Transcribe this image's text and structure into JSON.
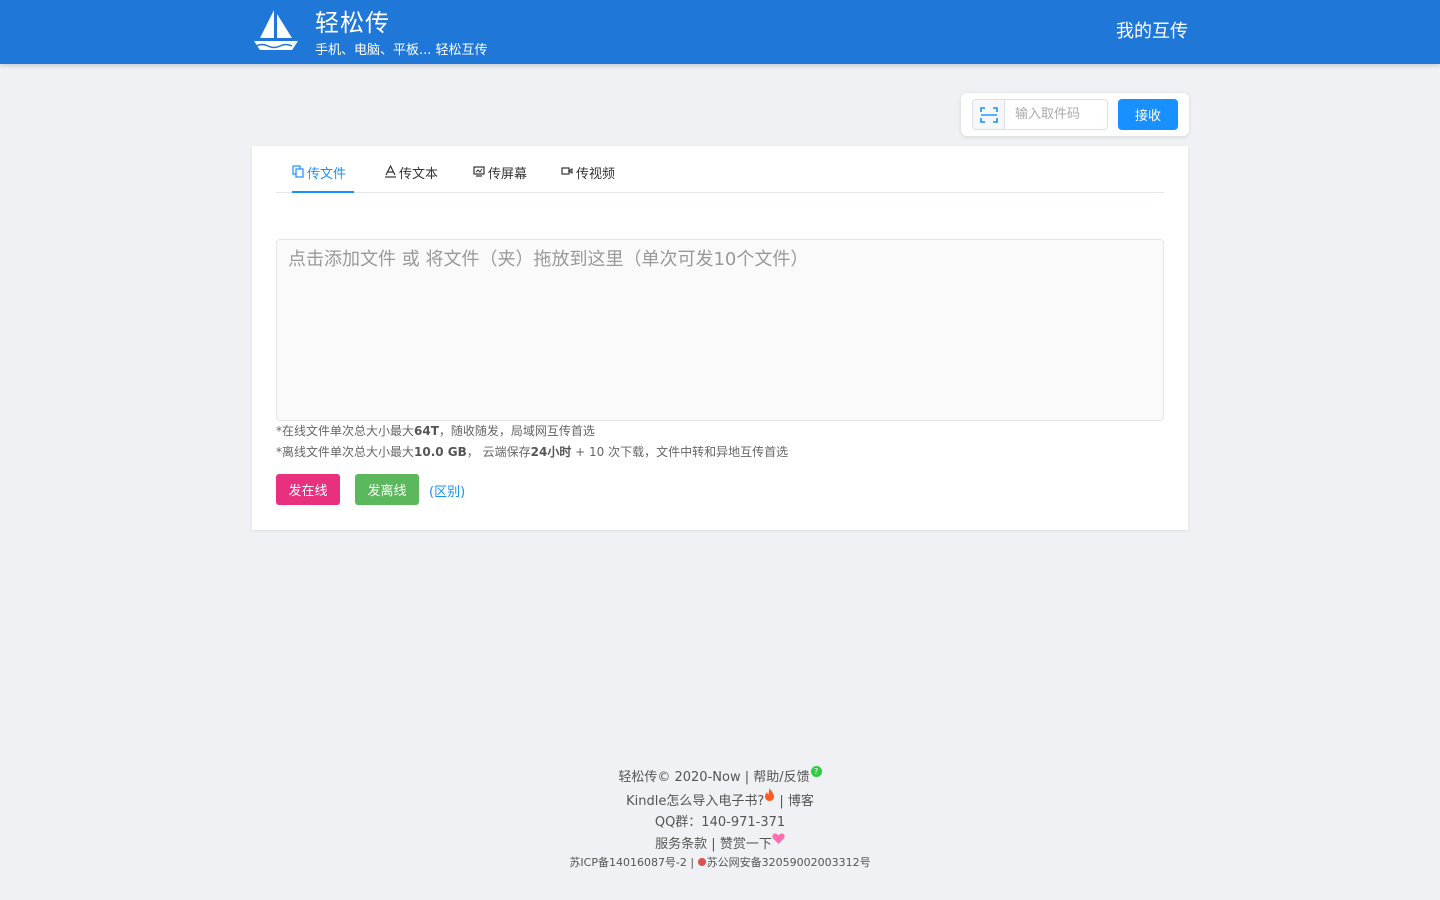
{
  "header": {
    "brand_title": "轻松传",
    "brand_subtitle": "手机、电脑、平板... 轻松互传",
    "my_transfers": "我的互传",
    "logo_icon": "sailboat-icon",
    "accent_color": "#1f78d8"
  },
  "receive": {
    "placeholder": "输入取件码",
    "button_label": "接收",
    "scan_icon": "scan-icon"
  },
  "tabs": [
    {
      "label": "传文件",
      "icon": "file-copy-icon",
      "active": true
    },
    {
      "label": "传文本",
      "icon": "text-icon",
      "active": false
    },
    {
      "label": "传屏幕",
      "icon": "screen-icon",
      "active": false
    },
    {
      "label": "传视频",
      "icon": "video-icon",
      "active": false
    }
  ],
  "dropzone": {
    "text": "点击添加文件 或 将文件（夹）拖放到这里（单次可发10个文件）"
  },
  "notes": {
    "online_prefix": "*在线文件单次总大小最大",
    "online_size": "64T",
    "online_suffix": "，随收随发，局域网互传首选",
    "offline_prefix": "*离线文件单次总大小最大",
    "offline_size": "10.0 GB",
    "offline_mid": "， 云端保存",
    "offline_hours": "24小时",
    "offline_suffix": " + 10 次下载，文件中转和异地互传首选"
  },
  "actions": {
    "send_online": "发在线",
    "send_offline": "发离线",
    "difference_link": "(区别)",
    "online_color": "#e8307f",
    "offline_color": "#5cb85c"
  },
  "footer": {
    "copyright": "轻松传© 2020-Now | ",
    "help_feedback": "帮助/反馈",
    "kindle": "Kindle怎么导入电子书?",
    "blog_sep": " | ",
    "blog": "博客",
    "qq_group": "QQ群：140-971-371",
    "terms": "服务条款",
    "sep2": " | ",
    "donate": "赞赏一下",
    "icp": "苏ICP备14016087号-2",
    "sep3": " | ",
    "police": "苏公网安备32059002003312号"
  }
}
